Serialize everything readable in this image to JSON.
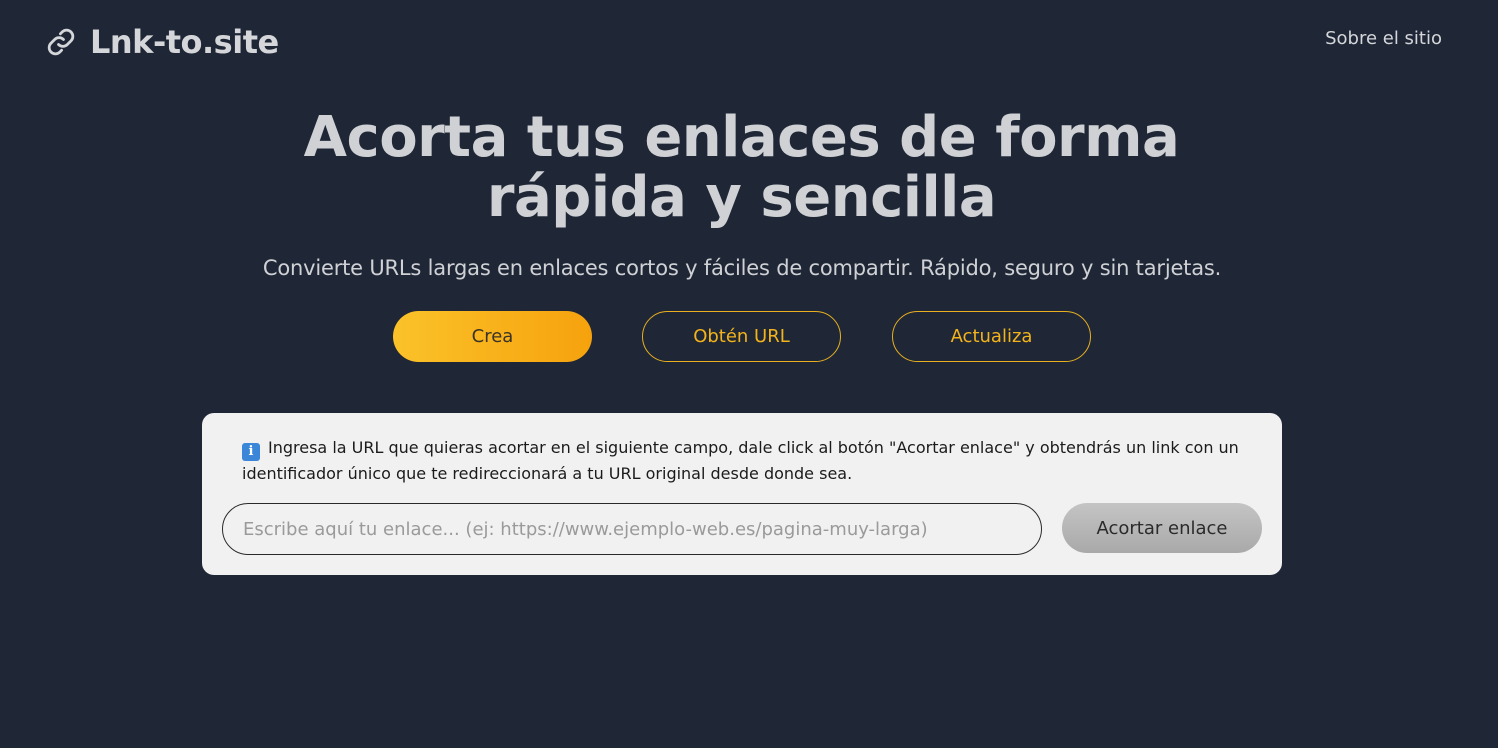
{
  "header": {
    "brand_name": "Lnk-to.site",
    "brand_icon": "link-icon",
    "nav_about": "Sobre el sitio"
  },
  "hero": {
    "title": "Acorta tus enlaces de forma rápida y sencilla",
    "subtitle": "Convierte URLs largas en enlaces cortos y fáciles de compartir. Rápido, seguro y sin tarjetas."
  },
  "actions": {
    "create": "Crea",
    "get_url": "Obtén URL",
    "update": "Actualiza"
  },
  "shortener": {
    "info_icon": "info-icon",
    "info_icon_glyph": "i",
    "info_text": "Ingresa la URL que quieras acortar en el siguiente campo, dale click al botón \"Acortar enlace\" y obtendrás un link con un identificador único que te redireccionará a tu URL original desde donde sea.",
    "input_value": "",
    "input_placeholder": "Escribe aquí tu enlace... (ej: https://www.ejemplo-web.es/pagina-muy-larga)",
    "submit_label": "Acortar enlace"
  },
  "colors": {
    "background": "#1f2737",
    "accent": "#f6a20d",
    "card": "#f1f1f1"
  }
}
